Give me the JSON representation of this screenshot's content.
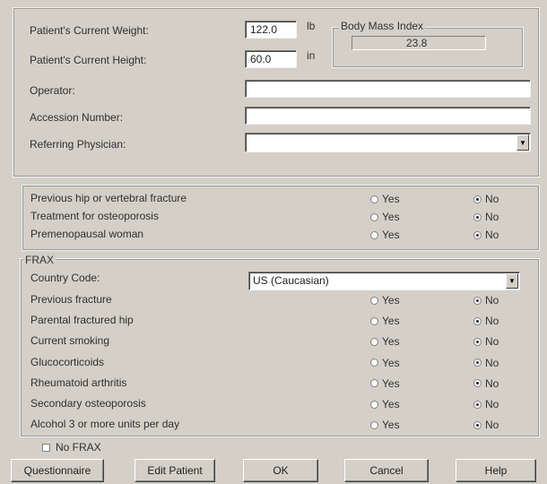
{
  "patient": {
    "weight_label": "Patient's Current Weight:",
    "weight_value": "122.0",
    "weight_unit": "lb",
    "height_label": "Patient's Current Height:",
    "height_value": "60.0",
    "height_unit": "in",
    "bmi_title": "Body Mass Index",
    "bmi_value": "23.8",
    "operator_label": "Operator:",
    "operator_value": "",
    "accession_label": "Accession Number:",
    "accession_value": "",
    "physician_label": "Referring Physician:",
    "physician_value": ""
  },
  "risk": {
    "yes_label": "Yes",
    "no_label": "No",
    "items": [
      {
        "label": "Previous hip or vertebral fracture",
        "selected": "No"
      },
      {
        "label": "Treatment for osteoporosis",
        "selected": "No"
      },
      {
        "label": "Premenopausal woman",
        "selected": "No"
      }
    ]
  },
  "frax": {
    "title": "FRAX",
    "country_label": "Country Code:",
    "country_value": "US (Caucasian)",
    "items": [
      {
        "label": "Previous fracture",
        "selected": "No"
      },
      {
        "label": "Parental fractured hip",
        "selected": "No"
      },
      {
        "label": "Current smoking",
        "selected": "No"
      },
      {
        "label": "Glucocorticoids",
        "selected": "No"
      },
      {
        "label": "Rheumatoid arthritis",
        "selected": "No"
      },
      {
        "label": "Secondary osteoporosis",
        "selected": "No"
      },
      {
        "label": "Alcohol 3 or more units per day",
        "selected": "No"
      }
    ],
    "no_frax_label": "No FRAX",
    "no_frax_checked": false
  },
  "buttons": {
    "questionnaire": "Questionnaire",
    "edit_patient": "Edit Patient",
    "ok": "OK",
    "cancel": "Cancel",
    "help": "Help"
  }
}
